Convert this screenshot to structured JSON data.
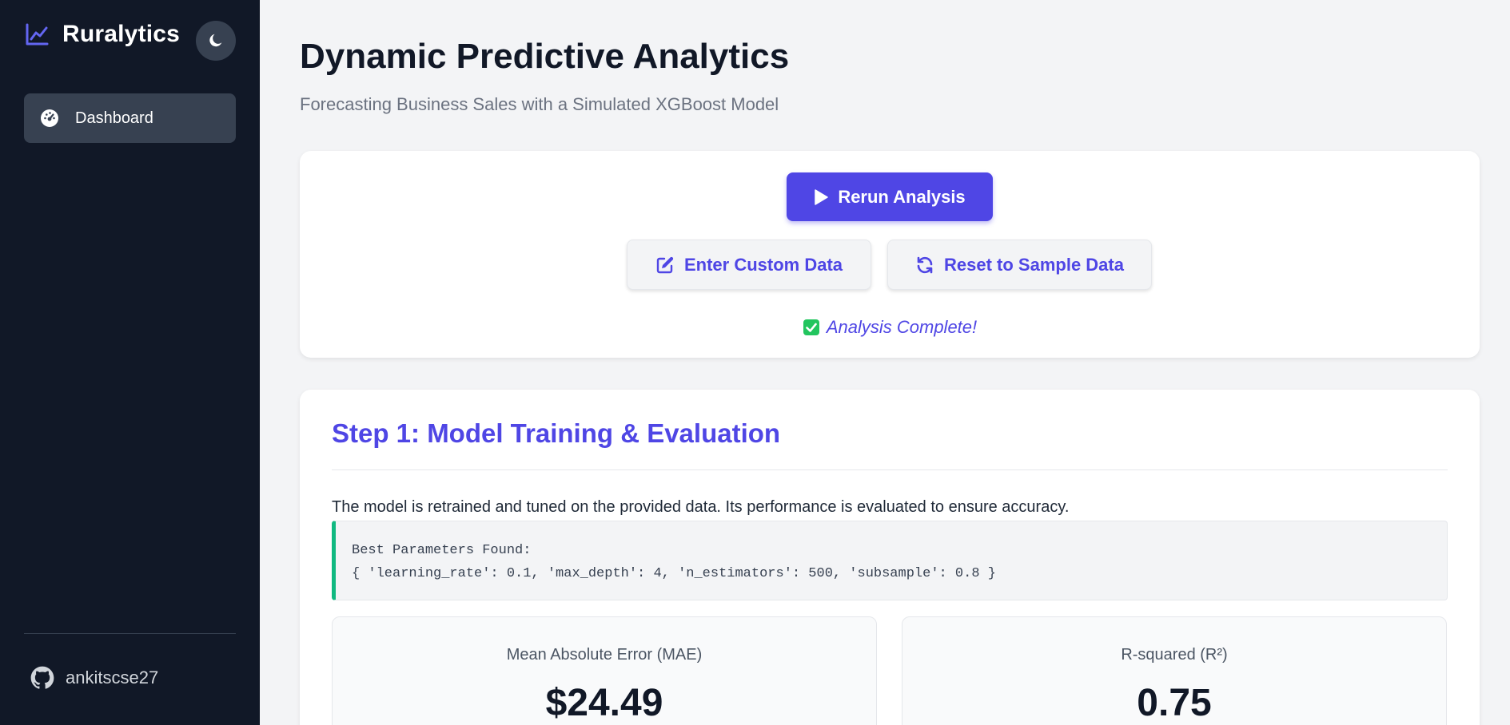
{
  "sidebar": {
    "brand": "Ruralytics",
    "nav": [
      {
        "label": "Dashboard",
        "icon": "gauge-icon"
      }
    ],
    "user": {
      "name": "ankitscse27",
      "icon": "github-icon"
    }
  },
  "header": {
    "title": "Dynamic Predictive Analytics",
    "subtitle": "Forecasting Business Sales with a Simulated XGBoost Model"
  },
  "actions": {
    "rerun_label": "Rerun Analysis",
    "custom_label": "Enter Custom Data",
    "reset_label": "Reset to Sample Data",
    "status": "Analysis Complete!"
  },
  "step1": {
    "title": "Step 1: Model Training & Evaluation",
    "description": "The model is retrained and tuned on the provided data. Its performance is evaluated to ensure accuracy.",
    "code_line1": "Best Parameters Found:",
    "code_line2": "{ 'learning_rate': 0.1, 'max_depth': 4, 'n_estimators': 500, 'subsample': 0.8 }",
    "metrics": [
      {
        "label": "Mean Absolute Error (MAE)",
        "value": "$24.49"
      },
      {
        "label": "R-squared (R²)",
        "value": "0.75"
      }
    ]
  },
  "colors": {
    "accent": "#4f46e5",
    "sidebar_bg": "#111827",
    "success": "#10b981"
  }
}
